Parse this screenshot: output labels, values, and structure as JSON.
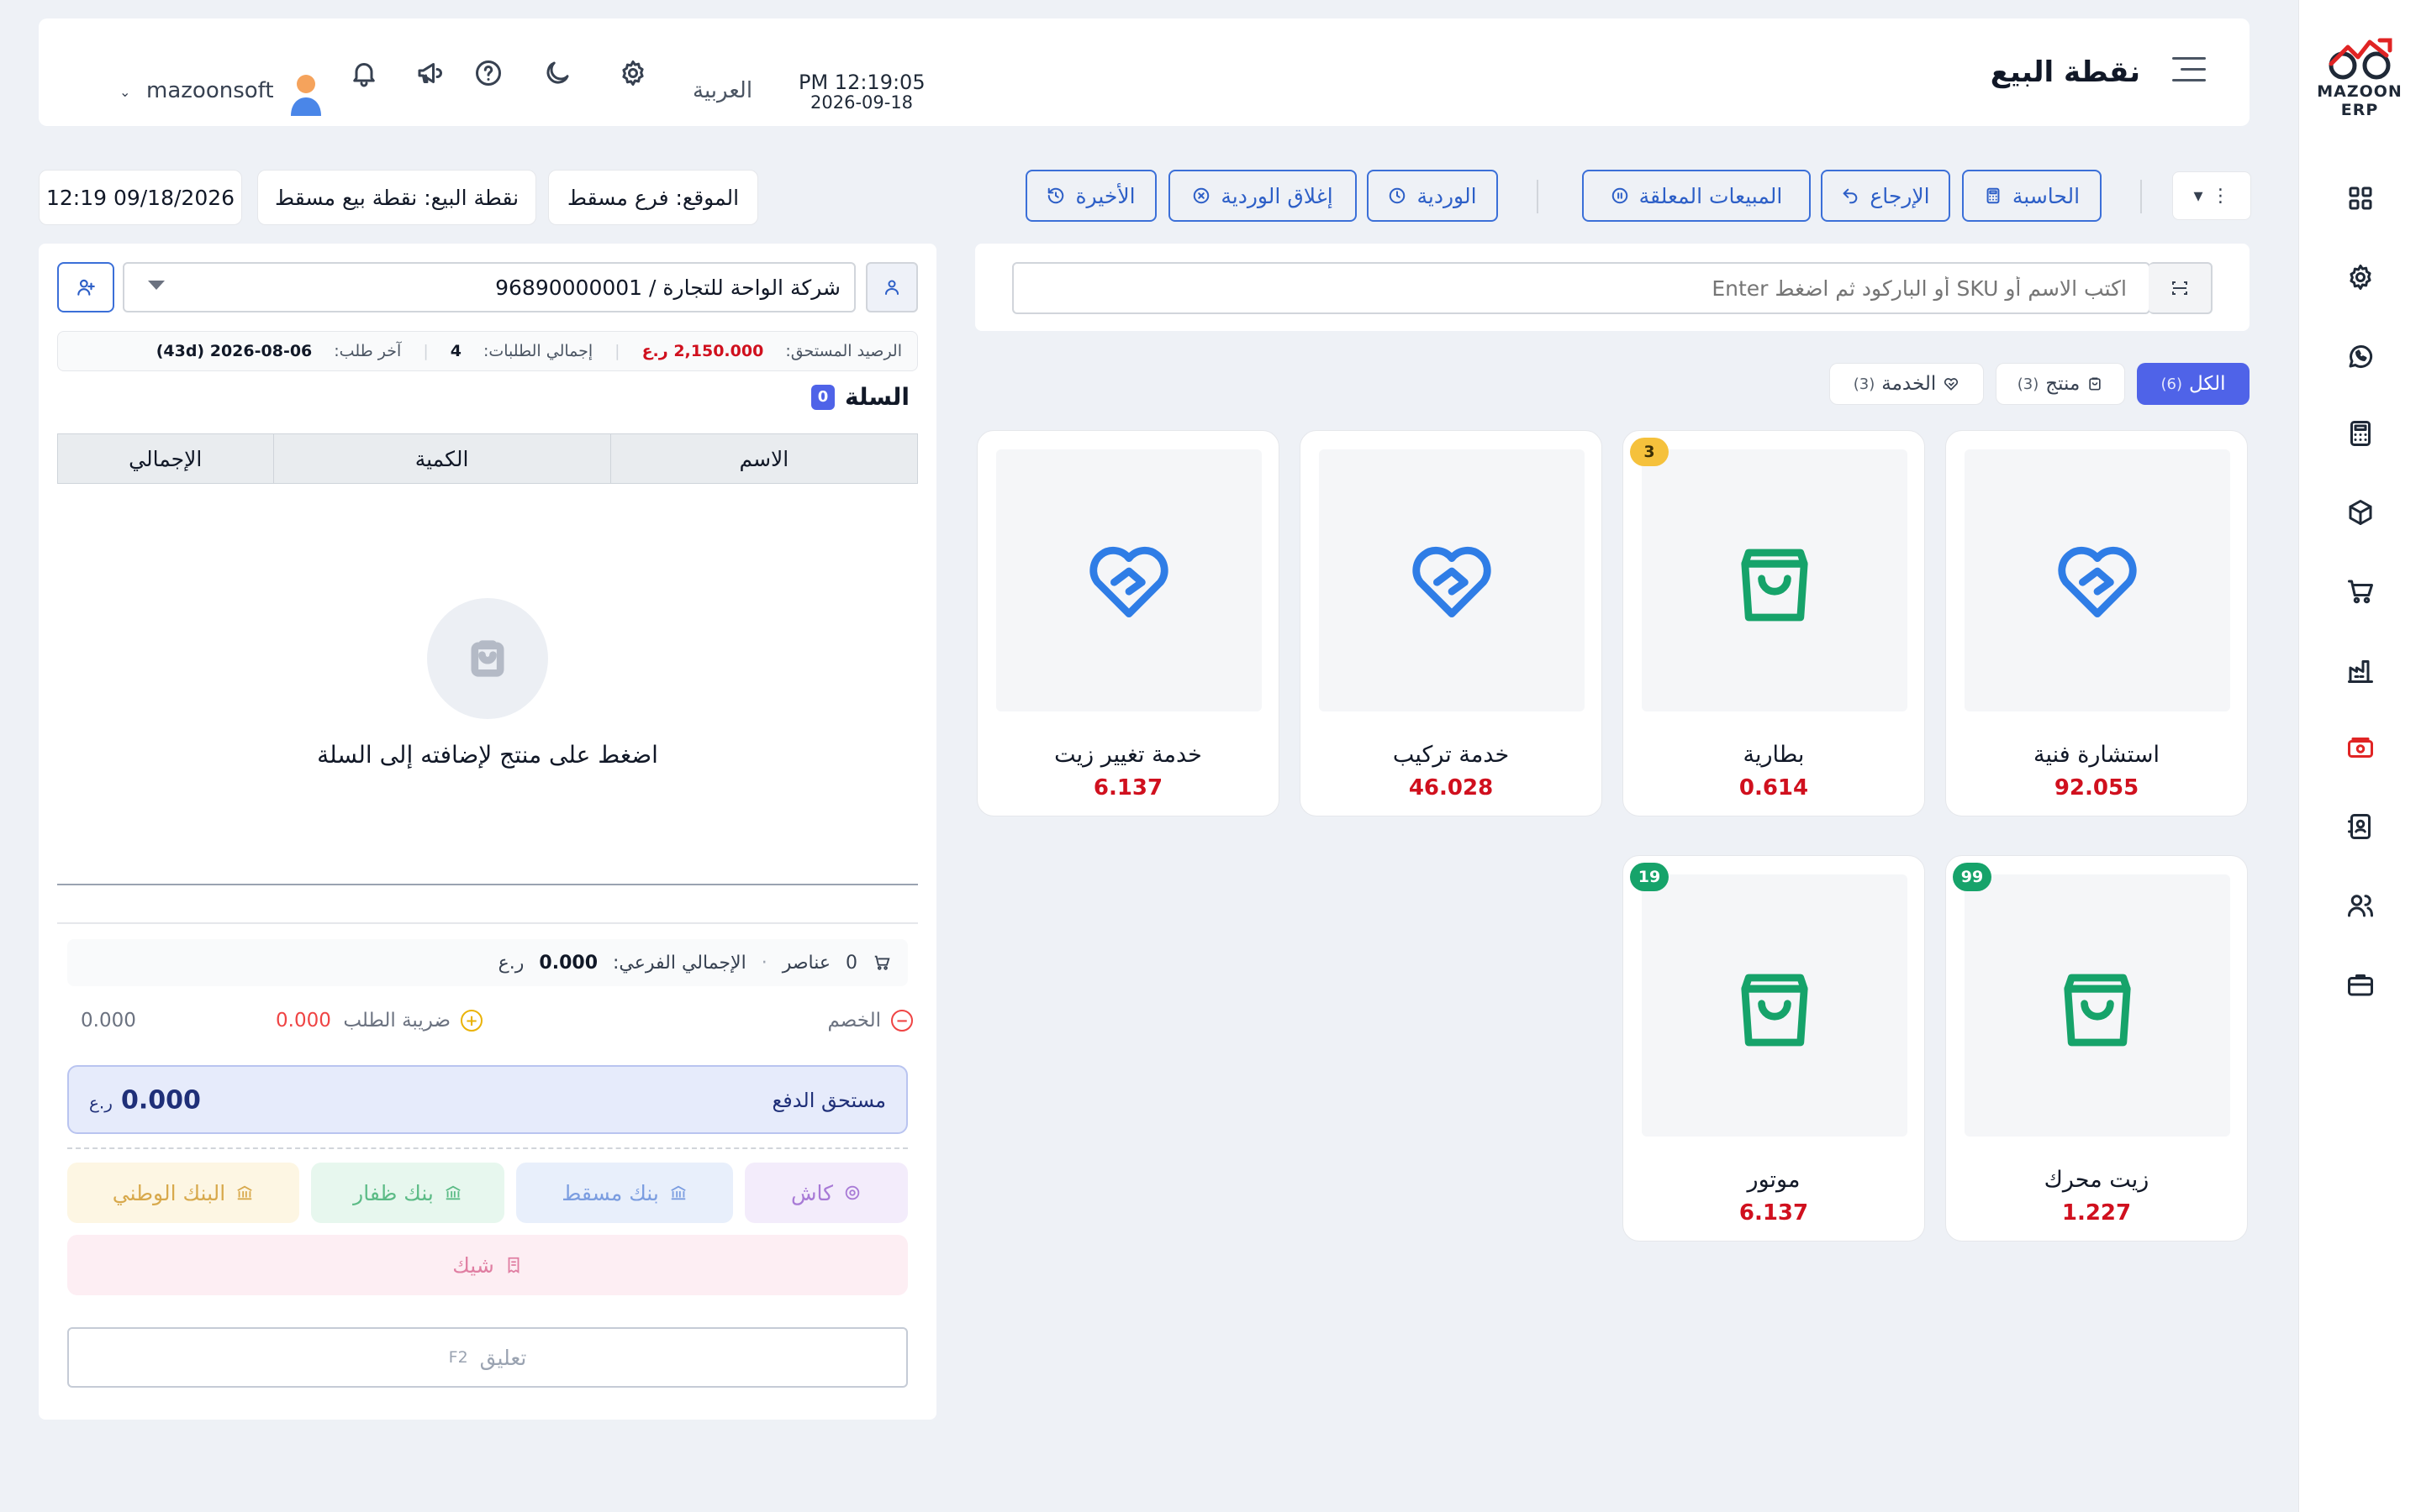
{
  "brand": {
    "logo_text": "MAZOON ERP"
  },
  "header": {
    "title": "نقطة البيع",
    "language": "العربية",
    "time": "PM 12:19:05",
    "date": "2026-09-18",
    "username": "mazoonsoft"
  },
  "toolbar": {
    "calculator": "الحاسبة",
    "returns": "الإرجاع",
    "held_sales": "المبيعات المعلقة",
    "shift": "الوردية",
    "close_shift": "إغلاق الوردية",
    "recent": "الأخيرة"
  },
  "context": {
    "location": "الموقع: فرع مسقط",
    "pos": "نقطة البيع: نقطة بيع مسقط",
    "datetime": "12:19 09/18/2026"
  },
  "search": {
    "placeholder": "اكتب الاسم أو SKU أو الباركود ثم اضغط Enter"
  },
  "filters": [
    {
      "label": "الكل",
      "count": "(6)",
      "active": true
    },
    {
      "label": "منتج",
      "count": "(3)",
      "active": false
    },
    {
      "label": "الخدمة",
      "count": "(3)",
      "active": false
    }
  ],
  "products": [
    {
      "name": "استشارة فنية",
      "price": "92.055",
      "kind": "service",
      "badge": null
    },
    {
      "name": "بطارية",
      "price": "0.614",
      "kind": "product",
      "badge": "3"
    },
    {
      "name": "خدمة تركيب",
      "price": "46.028",
      "kind": "service",
      "badge": null
    },
    {
      "name": "خدمة تغيير زيت",
      "price": "6.137",
      "kind": "service",
      "badge": null
    },
    {
      "name": "زيت محرك",
      "price": "1.227",
      "kind": "product",
      "badge": "99"
    },
    {
      "name": "موتور",
      "price": "6.137",
      "kind": "product",
      "badge": "19"
    }
  ],
  "customer": {
    "selected": "شركة الواحة للتجارة / 96890000001",
    "balance_label": "الرصيد المستحق:",
    "balance_value": "2,150.000 ر.ع",
    "orders_label": "إجمالي الطلبات:",
    "orders_value": "4",
    "last_order_label": "آخر طلب:",
    "last_order_value": "2026-08-06 (43d)"
  },
  "cart": {
    "title": "السلة",
    "count": "0",
    "columns": [
      "الاسم",
      "الكمية",
      "الإجمالي"
    ],
    "empty_message": "اضغط على منتج لإضافته إلى السلة",
    "items_count": "0",
    "items_label": "عناصر",
    "subtotal_label": "الإجمالي الفرعي:",
    "subtotal_value": "0.000",
    "currency": "ر.ع",
    "discount_label": "الخصم",
    "discount_value": "0.000",
    "tax_label": "ضريبة الطلب",
    "tax_value": "0.000",
    "due_label": "مستحق الدفع",
    "due_value": "0.000"
  },
  "payments": {
    "cash": "كاش",
    "bank_muscat": "بنك مسقط",
    "bank_dhofar": "بنك ظفار",
    "national_bank": "البنك الوطني",
    "cheque": "شيك"
  },
  "suspend": {
    "label": "تعليق",
    "shortcut": "F2"
  },
  "colors": {
    "accent": "#4f63e8",
    "outline_blue": "#2d5fc7",
    "price_red": "#d0101e",
    "product_green": "#16a36a",
    "service_blue": "#2f7de6"
  }
}
